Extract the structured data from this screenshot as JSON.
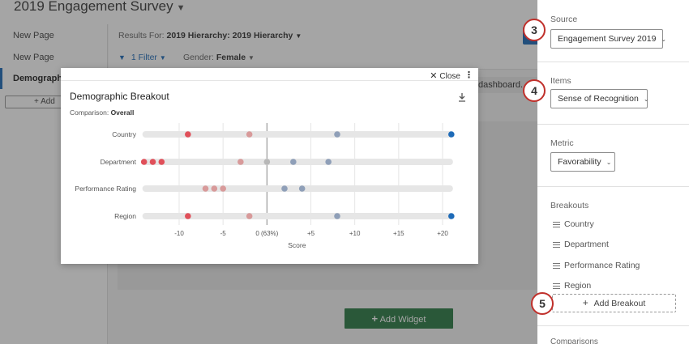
{
  "app": {
    "survey_title": "2019 Engagement Survey",
    "nav_items": [
      "New Page",
      "New Page",
      "Demographi"
    ],
    "add_page_label": "Add",
    "results_for_label": "Results For:",
    "hierarchy_value": "2019 Hierarchy: 2019 Hierarchy",
    "filter_label": "1 Filter",
    "gender_label": "Gender:",
    "gender_value": "Female",
    "dashboard_text": "dashboard.",
    "add_widget_label": "Add Widget"
  },
  "panel": {
    "source_label": "Source",
    "source_value": "Engagement Survey 2019",
    "items_label": "Items",
    "items_value": "Sense of Recognition",
    "metric_label": "Metric",
    "metric_value": "Favorability",
    "breakouts_label": "Breakouts",
    "breakouts": [
      "Country",
      "Department",
      "Performance Rating",
      "Region"
    ],
    "add_breakout_label": "Add Breakout",
    "next_section_label": "Comparisons",
    "callouts": [
      "3",
      "4",
      "5"
    ]
  },
  "modal": {
    "close_label": "Close",
    "title": "Demographic Breakout",
    "comparison_label": "Comparison:",
    "comparison_value": "Overall"
  },
  "colors": {
    "accent_blue": "#1e6bb8",
    "negative_red": "#e0505a",
    "faded_red": "#d89a9a",
    "faded_blue": "#8f9fb8",
    "add_widget_green": "#2c7a45",
    "callout_red": "#c0302b"
  },
  "chart_data": {
    "type": "scatter",
    "title": "",
    "xlabel": "Score",
    "ylabel": "",
    "xlim": [
      -14,
      22
    ],
    "xticks": [
      -10,
      -5,
      0,
      5,
      10,
      15,
      20
    ],
    "xtick_labels": [
      "-10",
      "-5",
      "0 (63%)",
      "+5",
      "+10",
      "+15",
      "+20"
    ],
    "categories": [
      "Country",
      "Department",
      "Performance Rating",
      "Region"
    ],
    "grid": true,
    "rows": [
      {
        "category": "Country",
        "range": [
          -14,
          21
        ],
        "points": [
          {
            "x": -9,
            "style": "neg"
          },
          {
            "x": -2,
            "style": "neg-faded"
          },
          {
            "x": 8,
            "style": "pos-faded"
          },
          {
            "x": 21,
            "style": "pos"
          }
        ]
      },
      {
        "category": "Department",
        "range": [
          -14,
          21
        ],
        "points": [
          {
            "x": -14,
            "style": "neg"
          },
          {
            "x": -13,
            "style": "neg"
          },
          {
            "x": -12,
            "style": "neg"
          },
          {
            "x": -3,
            "style": "neg-faded"
          },
          {
            "x": 0,
            "style": "neutral"
          },
          {
            "x": 3,
            "style": "pos-faded"
          },
          {
            "x": 7,
            "style": "pos-faded"
          }
        ]
      },
      {
        "category": "Performance Rating",
        "range": [
          -14,
          21
        ],
        "points": [
          {
            "x": -7,
            "style": "neg-faded"
          },
          {
            "x": -6,
            "style": "neg-faded"
          },
          {
            "x": -5,
            "style": "neg-faded"
          },
          {
            "x": 2,
            "style": "pos-faded"
          },
          {
            "x": 4,
            "style": "pos-faded"
          }
        ]
      },
      {
        "category": "Region",
        "range": [
          -14,
          21
        ],
        "points": [
          {
            "x": -9,
            "style": "neg"
          },
          {
            "x": -2,
            "style": "neg-faded"
          },
          {
            "x": 8,
            "style": "pos-faded"
          },
          {
            "x": 21,
            "style": "pos"
          }
        ]
      }
    ]
  }
}
